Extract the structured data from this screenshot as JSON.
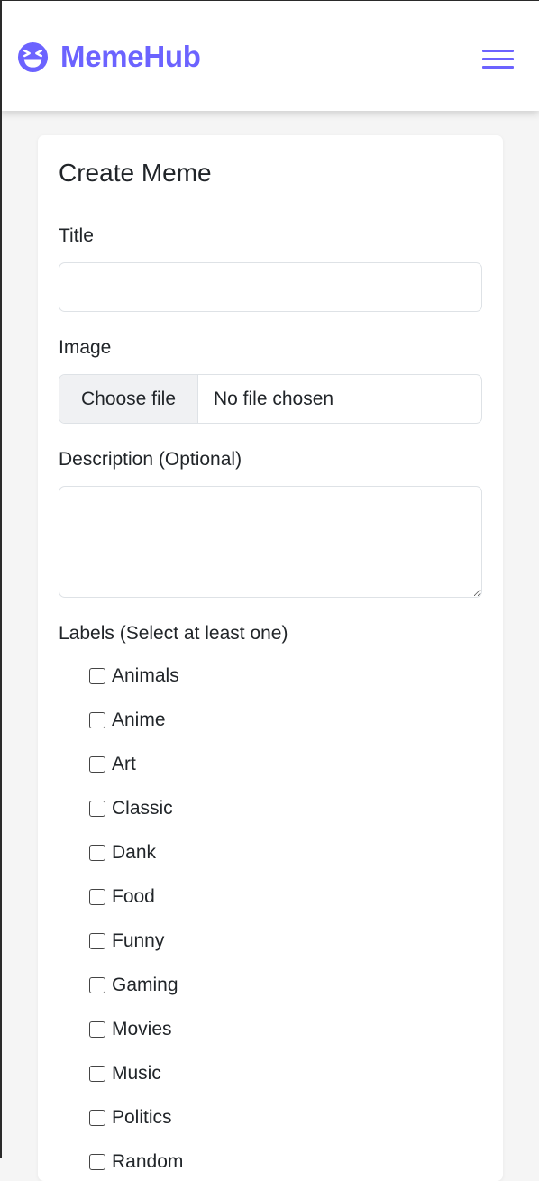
{
  "app": {
    "brand_name": "MemeHub",
    "brand_icon": "grinning-squint-face-icon",
    "menu_icon": "hamburger-menu-icon",
    "accent_color": "#6c63ff"
  },
  "form": {
    "title": "Create Meme",
    "title_field": {
      "label": "Title",
      "value": "",
      "placeholder": ""
    },
    "image_field": {
      "label": "Image",
      "button_label": "Choose file",
      "status": "No file chosen"
    },
    "description_field": {
      "label": "Description (Optional)",
      "value": "",
      "placeholder": ""
    },
    "labels_field": {
      "label": "Labels (Select at least one)",
      "options": [
        {
          "label": "Animals",
          "checked": false
        },
        {
          "label": "Anime",
          "checked": false
        },
        {
          "label": "Art",
          "checked": false
        },
        {
          "label": "Classic",
          "checked": false
        },
        {
          "label": "Dank",
          "checked": false
        },
        {
          "label": "Food",
          "checked": false
        },
        {
          "label": "Funny",
          "checked": false
        },
        {
          "label": "Gaming",
          "checked": false
        },
        {
          "label": "Movies",
          "checked": false
        },
        {
          "label": "Music",
          "checked": false
        },
        {
          "label": "Politics",
          "checked": false
        },
        {
          "label": "Random",
          "checked": false
        }
      ]
    }
  }
}
